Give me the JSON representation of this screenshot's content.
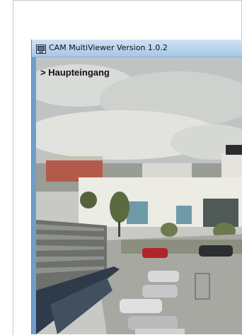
{
  "window": {
    "title": "CAM MultiViewer Version 1.0.2",
    "icon": "camera-viewer-icon"
  },
  "camera": {
    "label": "> Haupteingang",
    "scene": "parking-lot-camera-feed"
  }
}
